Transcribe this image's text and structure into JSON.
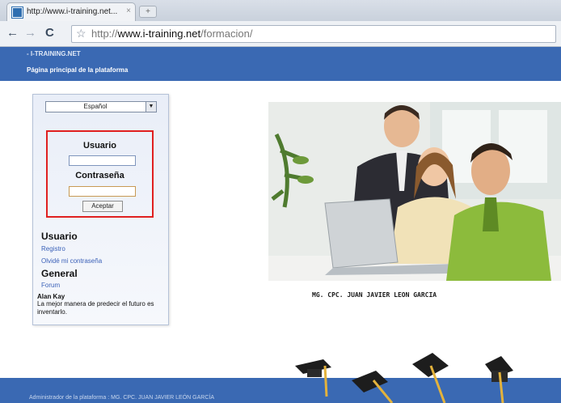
{
  "browser": {
    "tab_title": "http://www.i-training.net...",
    "tab_close": "×",
    "new_tab": "+",
    "back": "←",
    "forward": "→",
    "reload": "C",
    "url_prefix": "http://",
    "url_host": "www.i-training.net",
    "url_path": "/formacion/"
  },
  "site": {
    "name": "- I-TRAINING.NET",
    "subtitle": "Página principal de la plataforma"
  },
  "sidebar": {
    "language": "Español",
    "login": {
      "user_label": "Usuario",
      "user_value": "",
      "password_label": "Contraseña",
      "password_value": "",
      "accept_button": "Aceptar"
    },
    "user_section": {
      "title": "Usuario",
      "links": [
        "Registro",
        "Olvidé mi contraseña"
      ]
    },
    "general_section": {
      "title": "General",
      "links": [
        "Forum"
      ]
    },
    "quote": {
      "author": "Alan Kay",
      "text": "La mejor manera de predecir el futuro es inventarlo."
    }
  },
  "main": {
    "caption": "MG. CPC. JUAN JAVIER LEON GARCIA"
  },
  "footer": {
    "text": "Administrador de la plataforma : MG. CPC. JUAN JAVIER LEÓN GARCÍA"
  },
  "colors": {
    "header_blue": "#3a69b3",
    "link_blue": "#3b61b8",
    "highlight_red": "#e02020"
  }
}
